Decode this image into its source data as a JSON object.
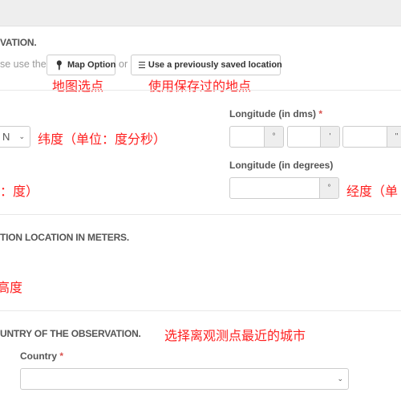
{
  "section_location": {
    "heading": "VATION.",
    "hint_prefix": "se use the",
    "map_button": "Map Option",
    "or": "or",
    "saved_button": "Use a previously saved location",
    "annot_map": "地图选点",
    "annot_saved": "使用保存过的地点"
  },
  "latitude": {
    "hemisphere": "N",
    "annot_dms": "纬度（单位：度分秒）",
    "annot_deg": "：度）"
  },
  "longitude": {
    "dms_label": "Longitude (in dms)",
    "required": "*",
    "deg_symbol": "°",
    "min_symbol": "'",
    "sec_symbol": "''",
    "deg_label": "Longitude (in degrees)",
    "annot_deg": "经度（单"
  },
  "section_altitude": {
    "heading": "TION LOCATION IN METERS.",
    "annot": "高度"
  },
  "section_country": {
    "heading": "UNTRY OF THE OBSERVATION.",
    "annot": "选择离观测点最近的城市",
    "country_label": "Country",
    "required": "*",
    "country_value": ""
  }
}
